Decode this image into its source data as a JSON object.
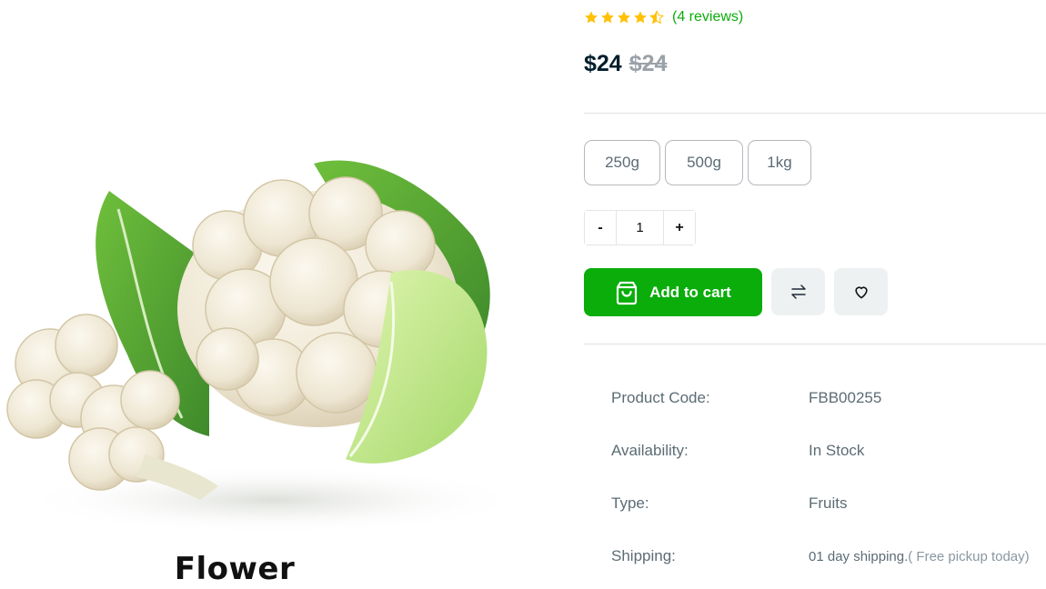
{
  "product": {
    "caption": "Flower",
    "image_label": "cauliflower-photo"
  },
  "rating": {
    "stars": 4.5,
    "max": 5,
    "reviews_text": "(4 reviews)",
    "star_color": "#ffc107"
  },
  "pricing": {
    "price": "$24",
    "old_price": "$24"
  },
  "weights": [
    "250g",
    "500g",
    "1kg"
  ],
  "quantity": {
    "minus": "-",
    "value": "1",
    "plus": "+"
  },
  "actions": {
    "add_to_cart": "Add to cart",
    "cart_icon": "shopping-bag-icon",
    "compare_icon": "arrows-swap-icon",
    "wishlist_icon": "heart-icon"
  },
  "specs": [
    {
      "label": "Product Code:",
      "value": "FBB00255"
    },
    {
      "label": "Availability:",
      "value": "In Stock"
    },
    {
      "label": "Type:",
      "value": "Fruits"
    },
    {
      "label": "Shipping:",
      "value": "01 day shipping.",
      "note": "( Free pickup today)"
    }
  ],
  "colors": {
    "accent": "#0aad0a",
    "price": "#001e2b",
    "muted_text": "#5c6c75"
  }
}
